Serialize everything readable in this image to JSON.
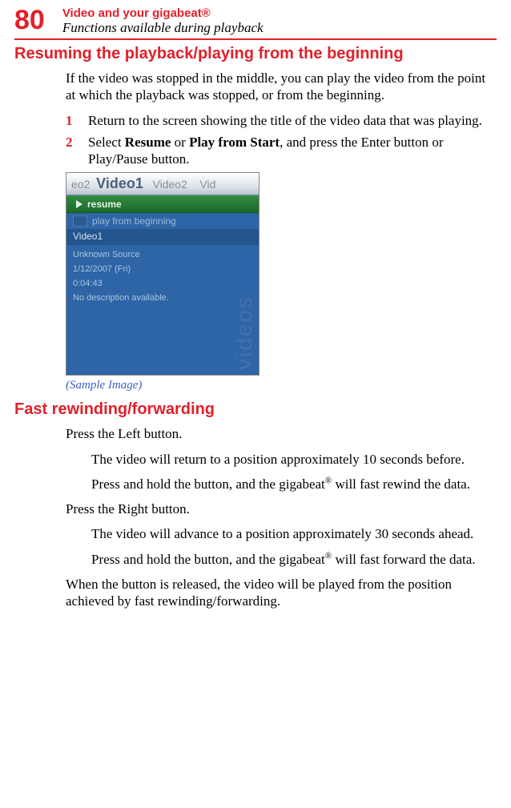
{
  "header": {
    "page_number": "80",
    "chapter": "Video and your gigabeat®",
    "subtitle": "Functions available during playback"
  },
  "section1": {
    "heading": "Resuming the playback/playing from the beginning",
    "intro": "If the video was stopped in the middle, you can play the video from the point at which the playback was stopped, or from the beginning.",
    "step1_num": "1",
    "step1": "Return to the screen showing the title of the video data that was playing.",
    "step2_num": "2",
    "step2_pre": "Select ",
    "step2_b1": "Resume",
    "step2_mid": " or ",
    "step2_b2": "Play from Start",
    "step2_post": ", and press the Enter button or Play/Pause button.",
    "caption": "(Sample Image)"
  },
  "sample": {
    "top_left": "eo2",
    "top_cur": "Video1",
    "top_next": "Video2",
    "top_right": "Vid",
    "resume": "resume",
    "play_begin": "play from beginning",
    "title": "Video1",
    "source": "Unknown Source",
    "date": "1/12/2007 (Fri)",
    "time": "0:04:43",
    "desc": "No description available.",
    "side": "videos"
  },
  "section2": {
    "heading": "Fast rewinding/forwarding",
    "press_left": "Press the Left button.",
    "left_effect": "The video will return to a position approximately 10 seconds before.",
    "left_hold_pre": "Press and hold the button, and the gigabeat",
    "left_hold_post": " will fast rewind the data.",
    "press_right": "Press the Right button.",
    "right_effect": "The video will advance to a position approximately 30 seconds ahead.",
    "right_hold_pre": "Press and hold the button, and the gigabeat",
    "right_hold_post": " will fast forward the data.",
    "release": "When the button is released, the video will be played from the position achieved by fast rewinding/forwarding.",
    "reg": "®"
  }
}
